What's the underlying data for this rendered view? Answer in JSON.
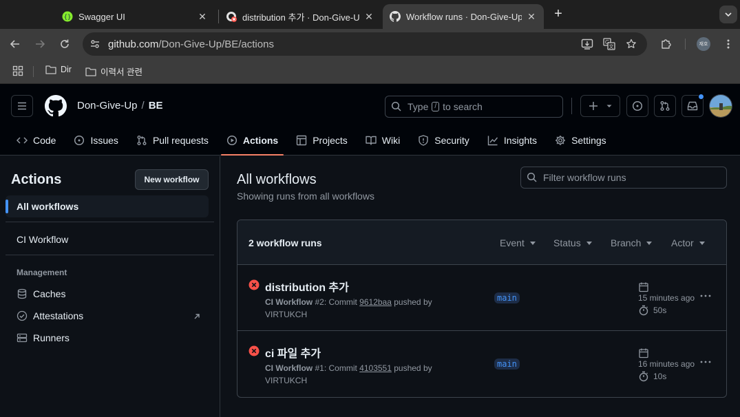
{
  "browser": {
    "tabs": [
      {
        "title": "Swagger UI",
        "icon": "swagger-icon"
      },
      {
        "title": "distribution 추가 · Don-Give-Up",
        "icon": "github-failing-icon"
      },
      {
        "title": "Workflow runs · Don-Give-Up",
        "icon": "github-icon"
      }
    ],
    "url_host": "github.com",
    "url_path": "/Don-Give-Up/BE/actions",
    "bookmarks": [
      "Dir",
      "이력서 관련"
    ],
    "profile_label": "재호"
  },
  "header": {
    "owner": "Don-Give-Up",
    "separator": "/",
    "repo": "BE",
    "search_prefix": "Type",
    "search_key": "/",
    "search_suffix": "to search"
  },
  "repo_nav": [
    {
      "label": "Code",
      "icon": "code-icon"
    },
    {
      "label": "Issues",
      "icon": "issue-icon"
    },
    {
      "label": "Pull requests",
      "icon": "pull-request-icon"
    },
    {
      "label": "Actions",
      "icon": "play-icon",
      "selected": true
    },
    {
      "label": "Projects",
      "icon": "table-icon"
    },
    {
      "label": "Wiki",
      "icon": "book-icon"
    },
    {
      "label": "Security",
      "icon": "shield-icon"
    },
    {
      "label": "Insights",
      "icon": "graph-icon"
    },
    {
      "label": "Settings",
      "icon": "gear-icon"
    }
  ],
  "sidebar": {
    "title": "Actions",
    "new_workflow": "New workflow",
    "all_workflows": "All workflows",
    "workflows": [
      "CI Workflow"
    ],
    "management_heading": "Management",
    "management": [
      "Caches",
      "Attestations",
      "Runners"
    ]
  },
  "main": {
    "title": "All workflows",
    "subtitle": "Showing runs from all workflows",
    "filter_placeholder": "Filter workflow runs",
    "runs_count": "2 workflow runs",
    "filters": [
      "Event",
      "Status",
      "Branch",
      "Actor"
    ],
    "runs": [
      {
        "title": "distribution 추가",
        "workflow": "CI Workflow",
        "number": "#2",
        "commit_prefix": ": Commit",
        "commit": "9612baa",
        "pushed_by": "pushed by",
        "actor": "VIRTUKCH",
        "branch": "main",
        "time": "15 minutes ago",
        "duration": "50s",
        "status": "failure"
      },
      {
        "title": "ci 파일 추가",
        "workflow": "CI Workflow",
        "number": "#1",
        "commit_prefix": ": Commit",
        "commit": "4103551",
        "pushed_by": "pushed by",
        "actor": "VIRTUKCH",
        "branch": "main",
        "time": "16 minutes ago",
        "duration": "10s",
        "status": "failure"
      }
    ]
  },
  "colors": {
    "failure": "#f85149",
    "accent": "#4493f8",
    "selected_underline": "#f78166"
  }
}
